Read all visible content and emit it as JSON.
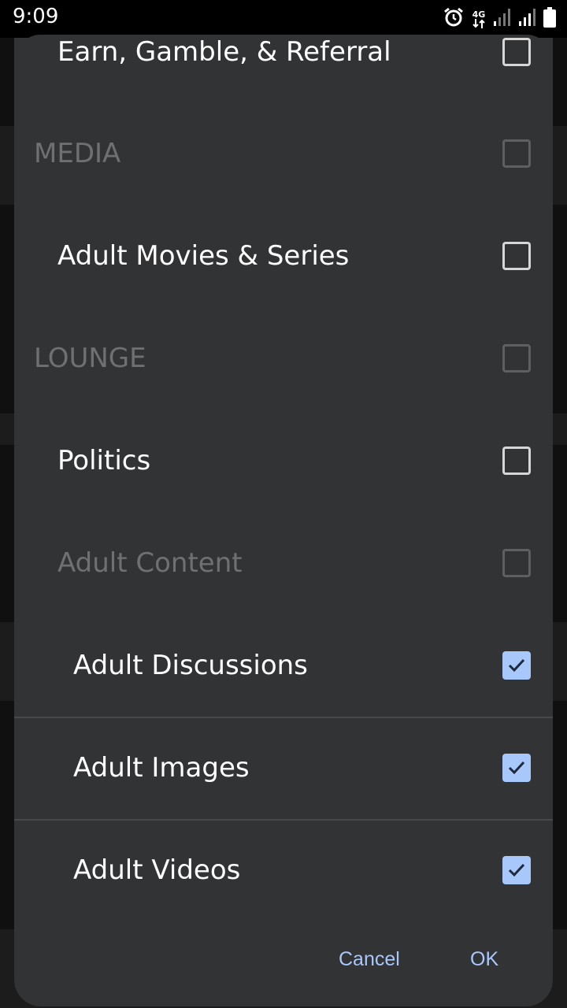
{
  "status_bar": {
    "time": "9:09",
    "network": "4G",
    "icons": [
      "alarm-icon",
      "signal-icon",
      "signal-icon",
      "battery-icon"
    ]
  },
  "dialog": {
    "items": [
      {
        "label": "Earn, Gamble, & Referral",
        "level": 1,
        "checked": false,
        "enabled": true
      },
      {
        "label": "MEDIA",
        "level": 0,
        "checked": false,
        "enabled": false
      },
      {
        "label": "Adult Movies & Series",
        "level": 1,
        "checked": false,
        "enabled": true
      },
      {
        "label": "LOUNGE",
        "level": 0,
        "checked": false,
        "enabled": false
      },
      {
        "label": "Politics",
        "level": 1,
        "checked": false,
        "enabled": true
      },
      {
        "label": "Adult Content",
        "level": 1,
        "checked": false,
        "enabled": false
      },
      {
        "label": "Adult Discussions",
        "level": 2,
        "checked": true,
        "enabled": true
      },
      {
        "label": "Adult Images",
        "level": 2,
        "checked": true,
        "enabled": true
      },
      {
        "label": "Adult Videos",
        "level": 2,
        "checked": true,
        "enabled": true
      }
    ],
    "cancel_label": "Cancel",
    "ok_label": "OK"
  },
  "colors": {
    "dialog_bg": "#323335",
    "accent": "#a8c7fa",
    "disabled_text": "#6f7072"
  }
}
